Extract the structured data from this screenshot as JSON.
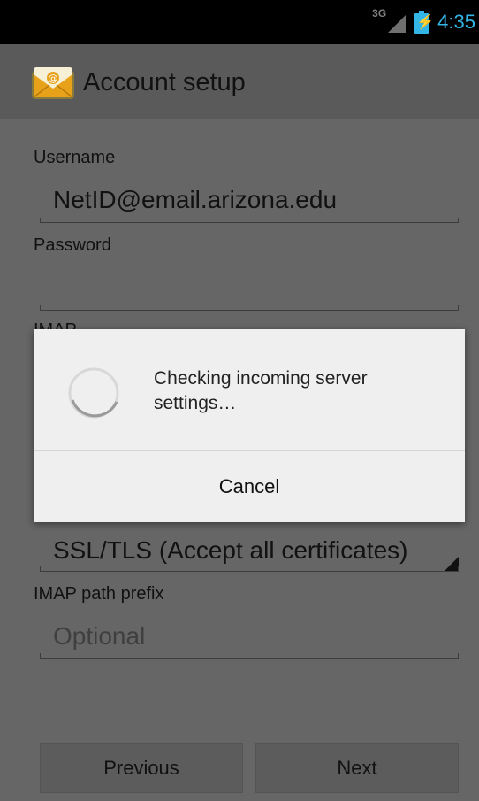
{
  "status_bar": {
    "network_type": "3G",
    "time": "4:35"
  },
  "action_bar": {
    "title": "Account setup",
    "icon": "email-app-icon"
  },
  "form": {
    "username_label": "Username",
    "username_value": "NetID@email.arizona.edu",
    "password_label": "Password",
    "password_value": "",
    "imap_server_label_partial": "IMAP",
    "security_type_value": "SSL/TLS (Accept all certificates)",
    "imap_path_label": "IMAP path prefix",
    "imap_path_placeholder": "Optional"
  },
  "buttons": {
    "previous": "Previous",
    "next": "Next"
  },
  "dialog": {
    "message": "Checking incoming server settings…",
    "cancel": "Cancel"
  },
  "colors": {
    "accent": "#33b5e5",
    "dim_background": "#666666",
    "dialog_background": "#efefef"
  }
}
